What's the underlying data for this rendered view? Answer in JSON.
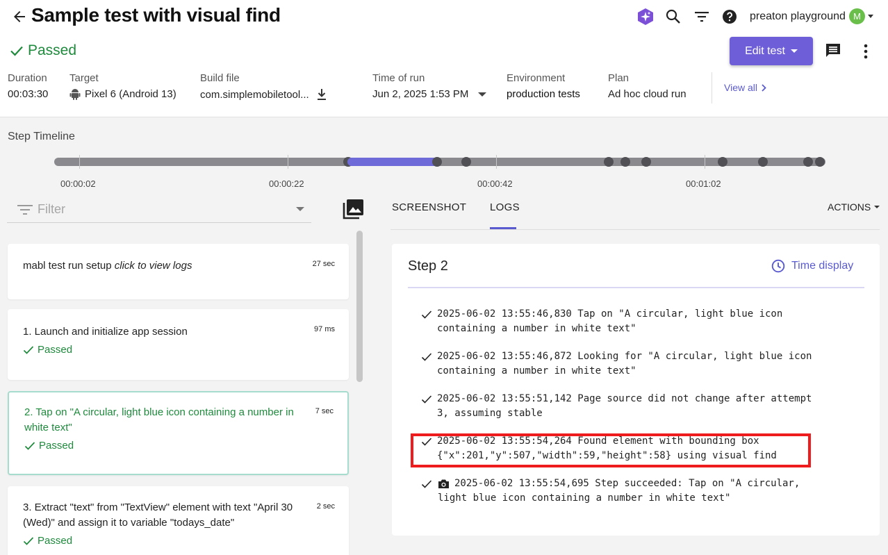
{
  "header": {
    "title": "Sample test with visual find",
    "user_name": "preaton playground",
    "avatar_initial": "M",
    "status": "Passed",
    "edit_button": "Edit test",
    "view_all": "View all"
  },
  "meta": {
    "duration": {
      "label": "Duration",
      "value": "00:03:30"
    },
    "target": {
      "label": "Target",
      "value": "Pixel 6 (Android 13)"
    },
    "build_file": {
      "label": "Build file",
      "value": "com.simplemobiletool..."
    },
    "time_of_run": {
      "label": "Time of run",
      "value": "Jun 2, 2025 1:53 PM"
    },
    "environment": {
      "label": "Environment",
      "value": "production tests"
    },
    "plan": {
      "label": "Plan",
      "value": "Ad hoc cloud run"
    }
  },
  "timeline": {
    "title": "Step Timeline",
    "labels": [
      "00:00:02",
      "00:00:22",
      "00:00:42",
      "00:01:02"
    ]
  },
  "filter": {
    "placeholder": "Filter"
  },
  "steps": [
    {
      "title": "mabl test run setup",
      "title_italic": "click to view logs",
      "time": "27 sec",
      "status": ""
    },
    {
      "title": "1. Launch and initialize app session",
      "time": "97 ms",
      "status": "Passed"
    },
    {
      "title": "2. Tap on \"A circular, light blue icon containing a number in white text\"",
      "time": "7 sec",
      "status": "Passed"
    },
    {
      "title": "3. Extract \"text\" from \"TextView\" element with text \"April 30 (Wed)\" and assign it to variable \"todays_date\"",
      "time": "2 sec",
      "status": "Passed"
    }
  ],
  "tabs": {
    "screenshot": "SCREENSHOT",
    "logs": "LOGS",
    "actions": "ACTIONS"
  },
  "log_panel": {
    "step_title": "Step 2",
    "time_display": "Time display",
    "entries": [
      {
        "line1": "2025-06-02 13:55:46,830 Tap on \"A circular, light blue icon",
        "line2": "containing a number in white text\""
      },
      {
        "line1": "2025-06-02 13:55:46,872 Looking for \"A circular, light blue icon",
        "line2": "containing a number in white text\""
      },
      {
        "line1": "2025-06-02 13:55:51,142 Page source did not change after attempt",
        "line2": "3, assuming stable"
      },
      {
        "line1": "2025-06-02 13:55:54,264 Found element with bounding box",
        "line2": "{\"x\":201,\"y\":507,\"width\":59,\"height\":58} using visual find"
      },
      {
        "line1": "2025-06-02 13:55:54,695 Step succeeded: Tap on \"A circular,",
        "line2": "light blue icon containing a number in white text\""
      }
    ]
  },
  "colors": {
    "accent": "#6e5fd8",
    "passed": "#1e8a3c",
    "highlight": "#ee1c1c",
    "timeline_active": "#6e6ad8"
  }
}
